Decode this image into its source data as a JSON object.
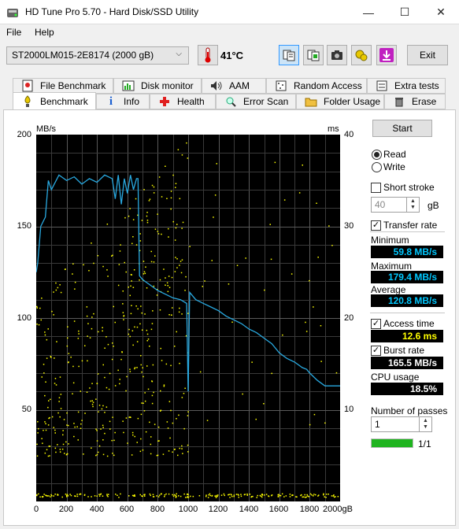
{
  "window": {
    "title": "HD Tune Pro 5.70 - Hard Disk/SSD Utility",
    "minimize_glyph": "—",
    "maximize_glyph": "☐",
    "close_glyph": "✕"
  },
  "menu": {
    "file": "File",
    "help": "Help"
  },
  "toolbar": {
    "drive": "ST2000LM015-2E8174 (2000 gB)",
    "temperature": "41°C",
    "exit_label": "Exit"
  },
  "tabs_row1": [
    {
      "label": "File Benchmark",
      "icon": "file-benchmark-icon"
    },
    {
      "label": "Disk monitor",
      "icon": "disk-monitor-icon"
    },
    {
      "label": "AAM",
      "icon": "speaker-icon"
    },
    {
      "label": "Random Access",
      "icon": "random-access-icon"
    },
    {
      "label": "Extra tests",
      "icon": "extra-tests-icon"
    }
  ],
  "tabs_row2": [
    {
      "label": "Benchmark",
      "icon": "benchmark-icon",
      "active": true
    },
    {
      "label": "Info",
      "icon": "info-icon"
    },
    {
      "label": "Health",
      "icon": "health-icon"
    },
    {
      "label": "Error Scan",
      "icon": "error-scan-icon"
    },
    {
      "label": "Folder Usage",
      "icon": "folder-icon"
    },
    {
      "label": "Erase",
      "icon": "erase-icon"
    }
  ],
  "side": {
    "start": "Start",
    "read": "Read",
    "write": "Write",
    "mode_selected": "read",
    "short_stroke": "Short stroke",
    "short_stroke_checked": false,
    "short_stroke_value": "40",
    "short_stroke_unit": "gB",
    "transfer_rate": "Transfer rate",
    "transfer_rate_checked": true,
    "minimum_label": "Minimum",
    "minimum_value": "59.8 MB/s",
    "maximum_label": "Maximum",
    "maximum_value": "179.4 MB/s",
    "average_label": "Average",
    "average_value": "120.8 MB/s",
    "access_time": "Access time",
    "access_time_checked": true,
    "access_time_value": "12.6 ms",
    "burst_rate": "Burst rate",
    "burst_rate_checked": true,
    "burst_rate_value": "165.5 MB/s",
    "cpu_label": "CPU usage",
    "cpu_value": "18.5%",
    "passes_label": "Number of passes",
    "passes_value": "1",
    "progress_fraction": 1.0,
    "progress_text": "1/1"
  },
  "colors": {
    "transfer_line": "#29a9e0",
    "access_dots": "#ffff00",
    "progress": "#1fb41f"
  },
  "chart_data": {
    "type": "line",
    "y_left_unit": "MB/s",
    "y_right_unit": "ms",
    "y_left_ticks": [
      "200",
      "150",
      "100",
      "50"
    ],
    "y_right_ticks": [
      "40",
      "30",
      "20",
      "10"
    ],
    "x_ticks": [
      "0",
      "200",
      "400",
      "600",
      "800",
      "1000",
      "1200",
      "1400",
      "1600",
      "1800",
      "2000gB"
    ],
    "ylim_left": [
      0,
      200
    ],
    "ylim_right": [
      0,
      40
    ],
    "xlim": [
      0,
      2000
    ],
    "series": [
      {
        "type": "transfer",
        "x": [
          0,
          10,
          30,
          60,
          80,
          100,
          150,
          200,
          250,
          300,
          350,
          400,
          450,
          500,
          520,
          540,
          560,
          580,
          600,
          620,
          640,
          660,
          670,
          680,
          700,
          750,
          800,
          850,
          900,
          950,
          990,
          1000,
          1010,
          1050,
          1100,
          1150,
          1200,
          1250,
          1300,
          1350,
          1400,
          1450,
          1500,
          1550,
          1600,
          1650,
          1700,
          1750,
          1780,
          1800,
          1850,
          1900,
          1950,
          2000
        ],
        "y": [
          125,
          130,
          150,
          155,
          175,
          170,
          178,
          175,
          177,
          173,
          176,
          174,
          178,
          176,
          165,
          178,
          162,
          176,
          168,
          178,
          170,
          176,
          176,
          123,
          121,
          118,
          115,
          113,
          111,
          110,
          108,
          60,
          114,
          110,
          108,
          106,
          104,
          101,
          99,
          97,
          94,
          92,
          89,
          86,
          81,
          78,
          76,
          73,
          72,
          70,
          66,
          63,
          63,
          63
        ]
      },
      {
        "type": "access_time_scatter",
        "baseline_ms": 0.5,
        "range_ms": [
          5,
          38
        ],
        "mean_ms": 12.6
      }
    ]
  }
}
